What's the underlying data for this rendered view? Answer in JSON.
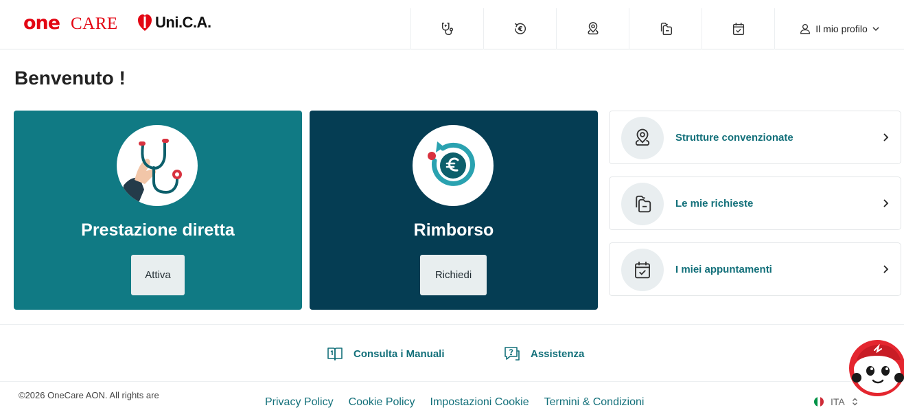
{
  "brand": {
    "one": "one",
    "care": "CARE",
    "partner": "Uni.C.A."
  },
  "header": {
    "nav_icons": [
      "stethoscope-icon",
      "refund-euro-icon",
      "location-pin-icon",
      "folders-icon",
      "calendar-check-icon"
    ],
    "profile_label": "Il mio profilo"
  },
  "welcome": "Benvenuto !",
  "cards": {
    "direct": {
      "title": "Prestazione diretta",
      "button": "Attiva"
    },
    "refund": {
      "title": "Rimborso",
      "button": "Richiedi"
    }
  },
  "quick_links": [
    {
      "label": "Strutture convenzionate",
      "icon": "location-pin-icon"
    },
    {
      "label": "Le mie richieste",
      "icon": "folders-icon"
    },
    {
      "label": "I miei appuntamenti",
      "icon": "calendar-check-icon"
    }
  ],
  "help": {
    "manuals": "Consulta i Manuali",
    "assistance": "Assistenza"
  },
  "footer": {
    "copyright": "©2026 OneCare AON. All rights are",
    "links": [
      "Privacy Policy",
      "Cookie Policy",
      "Impostazioni Cookie",
      "Termini & Condizioni"
    ],
    "language": "ITA"
  },
  "colors": {
    "brand_red": "#e30613",
    "teal": "#107a84",
    "navy": "#053d53",
    "link_teal": "#13707a"
  }
}
